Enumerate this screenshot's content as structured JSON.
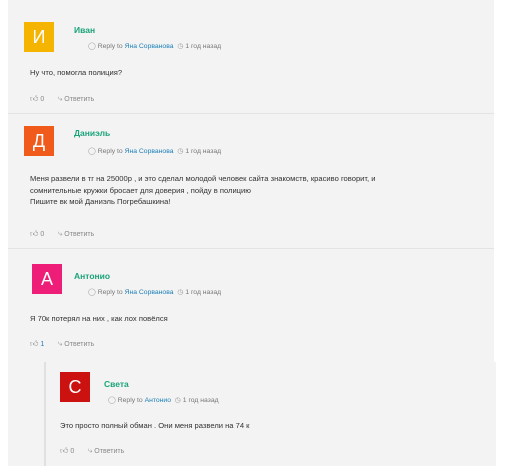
{
  "comments": [
    {
      "avatar_letter": "И",
      "avatar_color": "#f5b400",
      "name": "Иван",
      "reply_to_label": "Reply to",
      "reply_to_name": "Яна Сорванова",
      "time": "1 год назад",
      "text_lines": [
        "Ну что, помогла полиция?"
      ],
      "likes": "0",
      "reply_label": "Ответить"
    },
    {
      "avatar_letter": "Д",
      "avatar_color": "#f05a1a",
      "name": "Даниэль",
      "reply_to_label": "Reply to",
      "reply_to_name": "Яна Сорванова",
      "time": "1 год назад",
      "text_lines": [
        "Меня развели в тг на 25000р , и это сделал молодой человек сайта знакомств, красиво говорит, и",
        "сомнительные кружки бросает для доверия , пойду в полицию",
        "Пишите вк мой Даниэль Погребашкина!"
      ],
      "likes": "0",
      "reply_label": "Ответить"
    },
    {
      "avatar_letter": "А",
      "avatar_color": "#ee1e78",
      "name": "Антонио",
      "reply_to_label": "Reply to",
      "reply_to_name": "Яна Сорванова",
      "time": "1 год назад",
      "text_lines": [
        "Я 70к потерял на них , как лох повёлся"
      ],
      "likes": "1",
      "reply_label": "Ответить"
    },
    {
      "avatar_letter": "С",
      "avatar_color": "#cc1111",
      "name": "Света",
      "reply_to_label": "Reply to",
      "reply_to_name": "Антонио",
      "time": "1 год назад",
      "text_lines": [
        "Это просто полный обман . Они меня развели на 74 к"
      ],
      "likes": "0",
      "reply_label": "Ответить"
    }
  ]
}
